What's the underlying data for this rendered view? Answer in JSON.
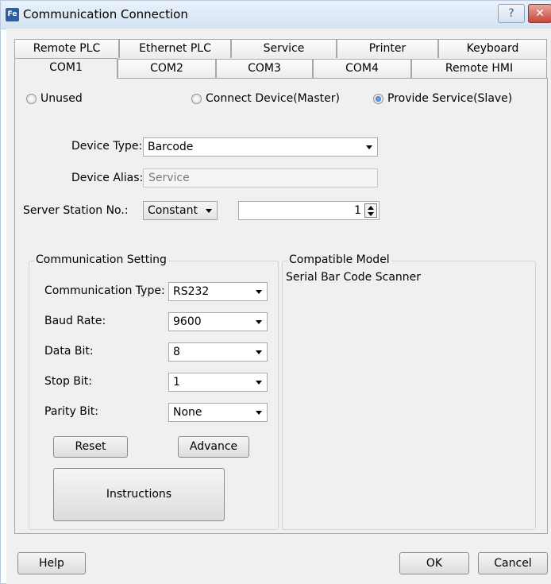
{
  "window": {
    "icon_text": "Fe",
    "title": "Communication Connection",
    "help_glyph": "?",
    "close_glyph": "✕"
  },
  "tabs": {
    "row1": [
      "Remote PLC",
      "Ethernet PLC",
      "Service",
      "Printer",
      "Keyboard"
    ],
    "row2": [
      "COM1",
      "COM2",
      "COM3",
      "COM4",
      "Remote HMI"
    ],
    "active": "COM1"
  },
  "mode": {
    "unused": "Unused",
    "master": "Connect Device(Master)",
    "slave": "Provide Service(Slave)",
    "selected": "slave"
  },
  "device": {
    "type_label": "Device Type:",
    "type_value": "Barcode",
    "alias_label": "Device Alias:",
    "alias_value": "Service",
    "station_label": "Server Station No.:",
    "station_mode": "Constant",
    "station_value": "1"
  },
  "comm": {
    "title": "Communication Setting",
    "type_label": "Communication Type:",
    "type_value": "RS232",
    "baud_label": "Baud Rate:",
    "baud_value": "9600",
    "data_label": "Data Bit:",
    "data_value": "8",
    "stop_label": "Stop Bit:",
    "stop_value": "1",
    "parity_label": "Parity Bit:",
    "parity_value": "None",
    "reset": "Reset",
    "advance": "Advance",
    "instructions": "Instructions"
  },
  "compatible": {
    "title": "Compatible Model",
    "model": "Serial Bar Code Scanner"
  },
  "footer": {
    "help": "Help",
    "ok": "OK",
    "cancel": "Cancel"
  }
}
